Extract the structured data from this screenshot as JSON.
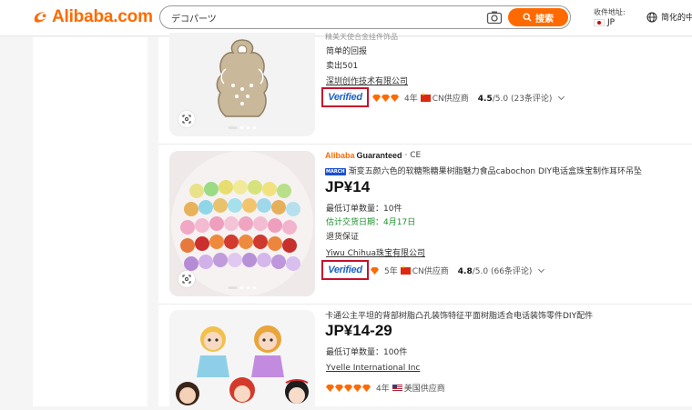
{
  "header": {
    "logo_text": "Alibaba.com",
    "search_value": "デコパーツ",
    "search_button": "搜索",
    "ship_to_label": "收件地址:",
    "ship_to_value": "JP",
    "language_label": "简化的中"
  },
  "products": [
    {
      "title_partial": "精美天使合金挂件饰品",
      "sub1": "简单的回报",
      "sub2": "卖出501",
      "supplier": "深圳创作技术有限公司",
      "verified": "Verified",
      "years": "4年",
      "origin": "CN供应商",
      "rating": "4.5",
      "rating_max": "/5.0",
      "reviews": "(23条评论)",
      "diamonds": 3
    },
    {
      "guarantee_brand": "Alibaba",
      "guarantee_word": "Guaranteed",
      "guarantee_extra": "· CE",
      "badge": "MARCH",
      "title": "渐变五颜六色的软糖熊糖果树脂魅力食品cabochon DIY电话盒珠宝制作耳环吊坠",
      "price": "JP¥14",
      "moq_label": "最低订单数量：",
      "moq_value": "10件",
      "delivery_label": "估计交货日期：",
      "delivery_value": "4月17日",
      "returns": "退货保证",
      "supplier": "Yiwu Chihua珠宝有限公司",
      "verified": "Verified",
      "years": "5年",
      "origin": "CN供应商",
      "rating": "4.8",
      "rating_max": "/5.0",
      "reviews": "(66条评论)",
      "diamonds": 1
    },
    {
      "title": "卡通公主平坦的背部树脂凸孔装饰特征平面树脂适合电话装饰零件DIY配件",
      "price": "JP¥14-29",
      "moq_label": "最低订单数量：",
      "moq_value": "100件",
      "supplier": "Yvelle International Inc",
      "years": "4年",
      "origin": "美国供应商",
      "diamonds": 5
    }
  ],
  "colors": {
    "accent": "#ff6a00",
    "verified_border": "#c8102e",
    "verified_text": "#1b63c6",
    "delivery": "#1b8e2b"
  }
}
